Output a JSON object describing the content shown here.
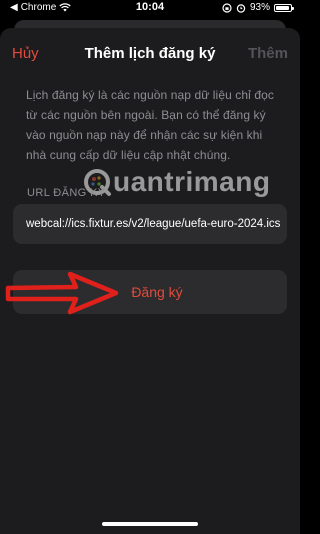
{
  "status_bar": {
    "back_app": "Chrome",
    "time": "10:04",
    "battery": "93%",
    "battery_level": 0.93
  },
  "nav": {
    "cancel_label": "Hủy",
    "title": "Thêm lịch đăng ký",
    "add_label": "Thêm"
  },
  "description": "Lịch đăng ký là các nguồn nạp dữ liệu chỉ đọc từ các nguồn bên ngoài. Bạn có thể đăng ký vào nguồn nạp này để nhận các sự kiện khi nhà cung cấp dữ liệu cập nhật chúng.",
  "watermark": {
    "text": "uantrimang"
  },
  "url_section": {
    "label": "URL ĐĂNG KÝ",
    "value": "webcal://ics.fixtur.es/v2/league/uefa-euro-2024.ics"
  },
  "subscribe_button": {
    "label": "Đăng ký"
  },
  "colors": {
    "accent": "#e24b3b",
    "sheet_bg": "#1c1c1e",
    "cell_bg": "#2c2c2e",
    "secondary_text": "#8e8e93",
    "annotation_arrow": "#e0201b"
  }
}
